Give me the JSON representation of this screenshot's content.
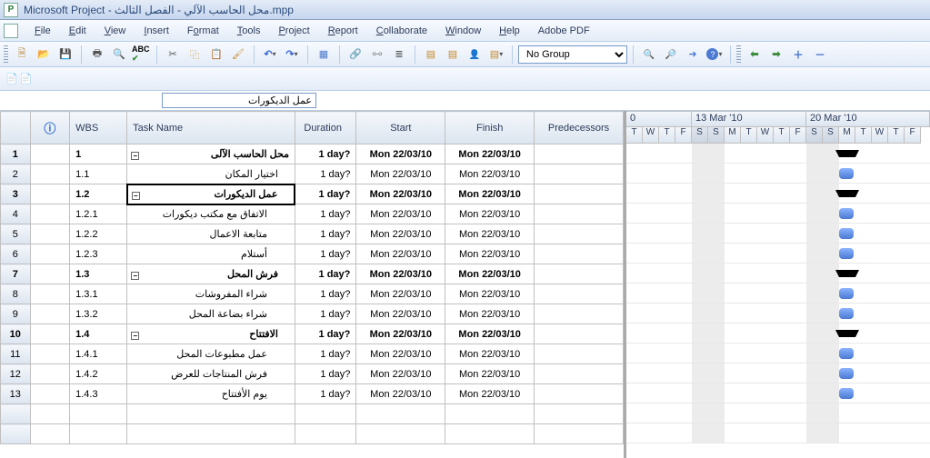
{
  "title": "Microsoft Project - محل الحاسب الآلي - الفصل الثالث.mpp",
  "menu": [
    "File",
    "Edit",
    "View",
    "Insert",
    "Format",
    "Tools",
    "Project",
    "Report",
    "Collaborate",
    "Window",
    "Help",
    "Adobe PDF"
  ],
  "menu_accel": [
    "F",
    "E",
    "V",
    "I",
    "o",
    "T",
    "P",
    "R",
    "C",
    "W",
    "H",
    ""
  ],
  "group_filter": "No Group",
  "edit_value": "عمل الديكورات",
  "columns": {
    "wbs": "WBS",
    "name": "Task Name",
    "duration": "Duration",
    "start": "Start",
    "finish": "Finish",
    "pred": "Predecessors"
  },
  "tasks": [
    {
      "row": 1,
      "wbs": "1",
      "name": "محل الحاسب الآلى",
      "dur": "1 day?",
      "start": "Mon 22/03/10",
      "finish": "Mon 22/03/10",
      "bold": true,
      "summary": true,
      "level": 0
    },
    {
      "row": 2,
      "wbs": "1.1",
      "name": "اختيار المكان",
      "dur": "1 day?",
      "start": "Mon 22/03/10",
      "finish": "Mon 22/03/10",
      "bold": false,
      "summary": false,
      "level": 1
    },
    {
      "row": 3,
      "wbs": "1.2",
      "name": "عمل الديكورات",
      "dur": "1 day?",
      "start": "Mon 22/03/10",
      "finish": "Mon 22/03/10",
      "bold": true,
      "summary": true,
      "level": 1,
      "selected": true
    },
    {
      "row": 4,
      "wbs": "1.2.1",
      "name": "الاتفاق مع مكتب ديكورات",
      "dur": "1 day?",
      "start": "Mon 22/03/10",
      "finish": "Mon 22/03/10",
      "bold": false,
      "summary": false,
      "level": 2
    },
    {
      "row": 5,
      "wbs": "1.2.2",
      "name": "متابعة الاعمال",
      "dur": "1 day?",
      "start": "Mon 22/03/10",
      "finish": "Mon 22/03/10",
      "bold": false,
      "summary": false,
      "level": 2
    },
    {
      "row": 6,
      "wbs": "1.2.3",
      "name": "أستلام",
      "dur": "1 day?",
      "start": "Mon 22/03/10",
      "finish": "Mon 22/03/10",
      "bold": false,
      "summary": false,
      "level": 2
    },
    {
      "row": 7,
      "wbs": "1.3",
      "name": "فرش المحل",
      "dur": "1 day?",
      "start": "Mon 22/03/10",
      "finish": "Mon 22/03/10",
      "bold": true,
      "summary": true,
      "level": 1
    },
    {
      "row": 8,
      "wbs": "1.3.1",
      "name": "شراء المفروشات",
      "dur": "1 day?",
      "start": "Mon 22/03/10",
      "finish": "Mon 22/03/10",
      "bold": false,
      "summary": false,
      "level": 2
    },
    {
      "row": 9,
      "wbs": "1.3.2",
      "name": "شراء بضاعة المحل",
      "dur": "1 day?",
      "start": "Mon 22/03/10",
      "finish": "Mon 22/03/10",
      "bold": false,
      "summary": false,
      "level": 2
    },
    {
      "row": 10,
      "wbs": "1.4",
      "name": "الافتتاح",
      "dur": "1 day?",
      "start": "Mon 22/03/10",
      "finish": "Mon 22/03/10",
      "bold": true,
      "summary": true,
      "level": 1
    },
    {
      "row": 11,
      "wbs": "1.4.1",
      "name": "عمل مطبوعات المحل",
      "dur": "1 day?",
      "start": "Mon 22/03/10",
      "finish": "Mon 22/03/10",
      "bold": false,
      "summary": false,
      "level": 2
    },
    {
      "row": 12,
      "wbs": "1.4.2",
      "name": "فرش المنتاجات للعرض",
      "dur": "1 day?",
      "start": "Mon 22/03/10",
      "finish": "Mon 22/03/10",
      "bold": false,
      "summary": false,
      "level": 2
    },
    {
      "row": 13,
      "wbs": "1.4.3",
      "name": "يوم الأفتتاح",
      "dur": "1 day?",
      "start": "Mon 22/03/10",
      "finish": "Mon 22/03/10",
      "bold": false,
      "summary": false,
      "level": 2
    }
  ],
  "timeline": {
    "header_prefix": "0",
    "weeks": [
      "13 Mar '10",
      "20 Mar '10"
    ],
    "days": [
      "T",
      "W",
      "T",
      "F",
      "S",
      "S",
      "M",
      "T",
      "W",
      "T",
      "F",
      "S",
      "S",
      "M",
      "T",
      "W",
      "T",
      "F"
    ]
  }
}
